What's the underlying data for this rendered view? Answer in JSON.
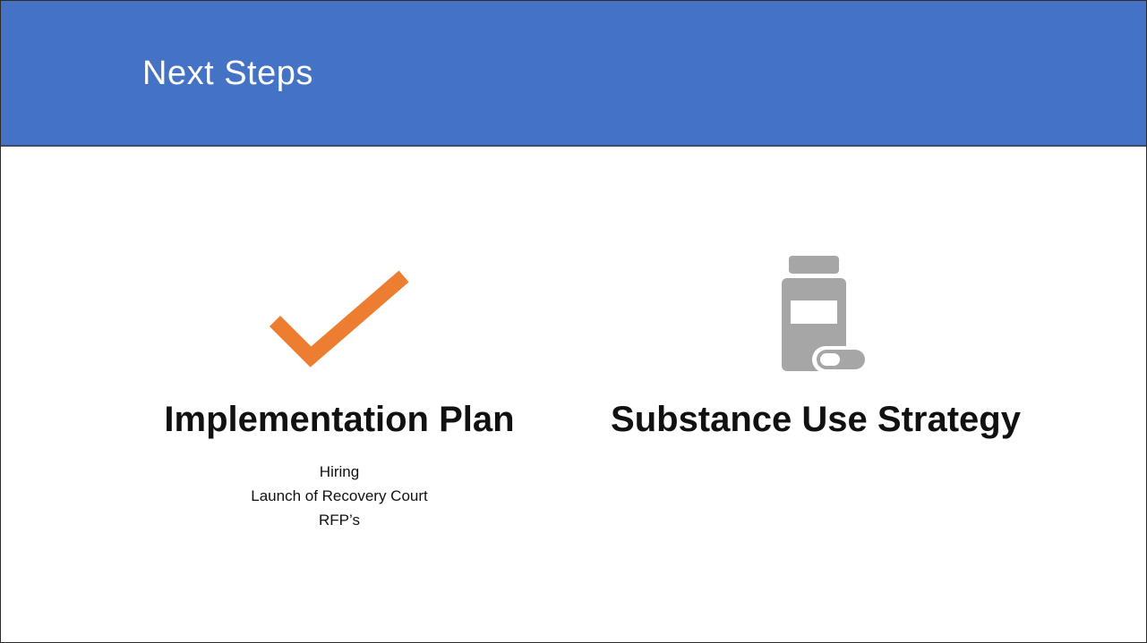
{
  "slide": {
    "title": "Next Steps",
    "header_color": "#4472c4"
  },
  "left": {
    "icon": "checkmark-icon",
    "icon_color": "#ed7d31",
    "heading": "Implementation Plan",
    "items": [
      "Hiring",
      "Launch of Recovery Court",
      "RFP’s"
    ]
  },
  "right": {
    "icon": "medicine-bottle-icon",
    "icon_color": "#a6a6a6",
    "heading": "Substance Use Strategy"
  }
}
